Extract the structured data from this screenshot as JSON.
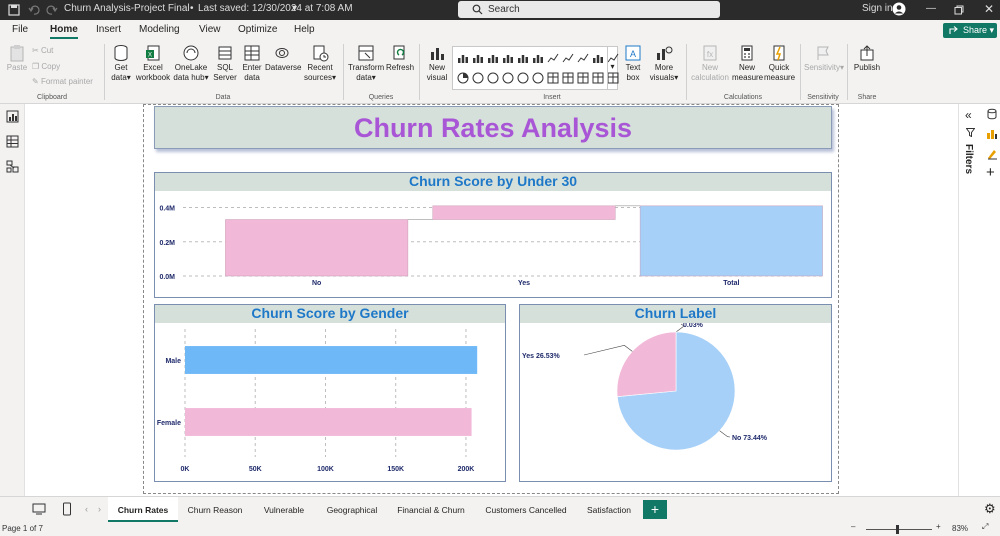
{
  "titlebar": {
    "file_title": "Churn Analysis-Project Final",
    "saved": "Last saved: 12/30/2024 at 7:08 AM",
    "search_placeholder": "Search",
    "signin": "Sign in"
  },
  "menu": {
    "items": [
      "File",
      "Home",
      "Insert",
      "Modeling",
      "View",
      "Optimize",
      "Help"
    ],
    "share": "Share"
  },
  "ribbon": {
    "clipboard": {
      "paste": "Paste",
      "cut": "Cut",
      "copy": "Copy",
      "format_painter": "Format painter",
      "group": "Clipboard"
    },
    "data": {
      "get_data": "Get data",
      "excel": "Excel workbook",
      "onelake": "OneLake data hub",
      "sql": "SQL Server",
      "enter": "Enter data",
      "dataverse": "Dataverse",
      "recent": "Recent sources",
      "group": "Data"
    },
    "queries": {
      "transform": "Transform data",
      "refresh": "Refresh",
      "group": "Queries"
    },
    "insert": {
      "new_visual": "New visual",
      "text_box": "Text box",
      "more_visuals": "More visuals",
      "group": "Insert"
    },
    "calculations": {
      "new_calc": "New calculation",
      "new_measure": "New measure",
      "quick_measure": "Quick measure",
      "group": "Calculations"
    },
    "sensitivity": {
      "label": "Sensitivity",
      "group": "Sensitivity"
    },
    "share": {
      "publish": "Publish",
      "group": "Share"
    }
  },
  "report": {
    "title": "Churn Rates Analysis",
    "visual1_title": "Churn Score by Under 30",
    "visual2_title": "Churn Score by Gender",
    "visual3_title": "Churn Label"
  },
  "rightpane": {
    "filters": "Filters"
  },
  "tabs": [
    "Churn Rates",
    "Churn Reason",
    "Vulnerable",
    "Geographical",
    "Financial & Churn",
    "Customers Cancelled",
    "Satisfaction"
  ],
  "status": {
    "page": "Page 1 of 7",
    "zoom": "83%"
  },
  "colors": {
    "pink": "#f2b8d8",
    "blue": "#a6d0f8",
    "bar_blue": "#6eb8f8",
    "title_purple": "#a855d6",
    "accent": "#117865"
  },
  "chart_data": [
    {
      "type": "bar",
      "subtype": "waterfall",
      "title": "Churn Score by Under 30",
      "categories": [
        "No",
        "Yes",
        "Total"
      ],
      "values": [
        0.33,
        0.08,
        0.41
      ],
      "ylim": [
        0,
        0.45
      ],
      "yticks": [
        "0.0M",
        "0.2M",
        "0.4M"
      ],
      "ytick_values": [
        0,
        0.2,
        0.4
      ],
      "grid": true
    },
    {
      "type": "bar",
      "orientation": "horizontal",
      "title": "Churn Score by Gender",
      "categories": [
        "Male",
        "Female"
      ],
      "values": [
        208000,
        204000
      ],
      "xlim": [
        0,
        210000
      ],
      "xticks": [
        "0K",
        "50K",
        "100K",
        "150K",
        "200K"
      ],
      "xtick_values": [
        0,
        50000,
        100000,
        150000,
        200000
      ],
      "grid": true
    },
    {
      "type": "pie",
      "title": "Churn Label",
      "labels": [
        "No",
        "Yes",
        ""
      ],
      "values": [
        73.44,
        26.53,
        0.03
      ],
      "data_labels": [
        "No 73.44%",
        "Yes 26.53%",
        "0.03%"
      ]
    }
  ]
}
